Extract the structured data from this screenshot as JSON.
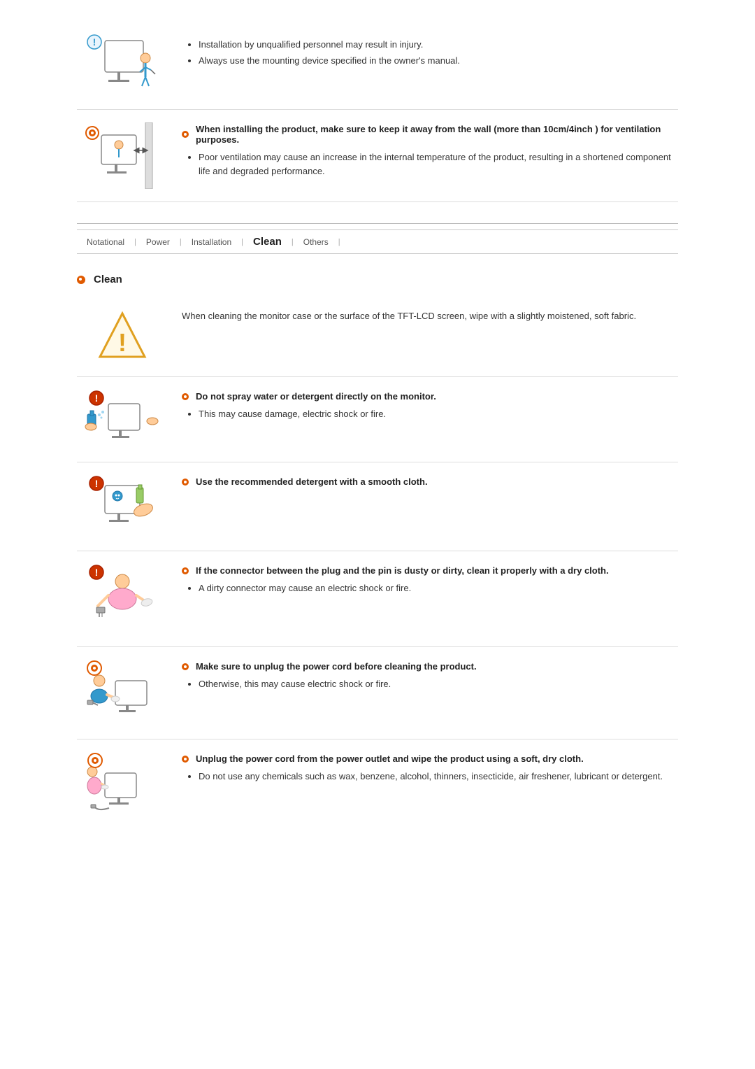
{
  "nav": {
    "tabs": [
      {
        "label": "Notational",
        "active": false
      },
      {
        "label": "Power",
        "active": false
      },
      {
        "label": "Installation",
        "active": false
      },
      {
        "label": "Clean",
        "active": true
      },
      {
        "label": "Others",
        "active": false
      }
    ]
  },
  "top_sections": [
    {
      "bullets": [
        "Installation by unqualified personnel may result in injury.",
        "Always use the mounting device specified in the owner's manual."
      ]
    },
    {
      "title": "When installing the product, make sure to keep it away from the wall (more than 10cm/4inch ) for ventilation purposes.",
      "bullets": [
        "Poor ventilation may cause an increase in the internal temperature of the product, resulting in a shortened component life and degraded performance."
      ]
    }
  ],
  "clean_section": {
    "heading": "Clean",
    "items": [
      {
        "id": "clean-intro",
        "text": "When cleaning the monitor case or the surface of the TFT-LCD screen, wipe with a slightly moistened, soft fabric.",
        "title": null
      },
      {
        "id": "no-spray",
        "title": "Do not spray water or detergent directly on the monitor.",
        "bullets": [
          "This may cause damage, electric shock or fire."
        ]
      },
      {
        "id": "recommended-detergent",
        "title": "Use the recommended detergent with a smooth cloth.",
        "bullets": []
      },
      {
        "id": "connector-clean",
        "title": "If the connector between the plug and the pin is dusty or dirty, clean it properly with a dry cloth.",
        "bullets": [
          "A dirty connector may cause an electric shock or fire."
        ]
      },
      {
        "id": "unplug-before-clean",
        "title": "Make sure to unplug the power cord before cleaning the product.",
        "bullets": [
          "Otherwise, this may cause electric shock or fire."
        ]
      },
      {
        "id": "wipe-product",
        "title": "Unplug the power cord from the power outlet and wipe the product using a soft, dry cloth.",
        "bullets": [
          "Do not use any chemicals such as wax, benzene, alcohol, thinners, insecticide, air freshener, lubricant or detergent."
        ]
      }
    ]
  }
}
